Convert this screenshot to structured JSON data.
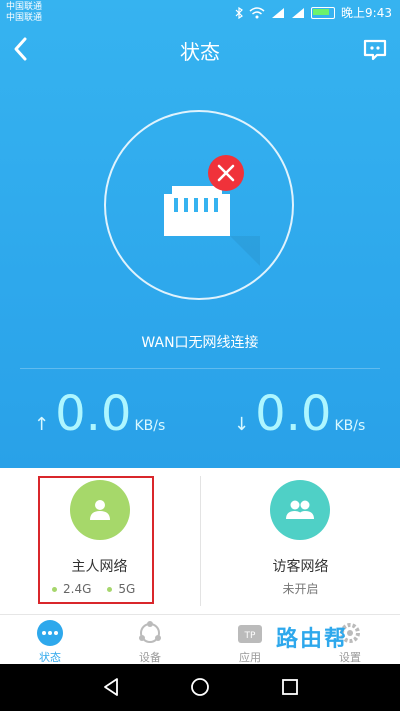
{
  "status_bar": {
    "carrier_1": "中国联通",
    "carrier_2": "中国联通",
    "time": "晚上9:43",
    "icons": [
      "bluetooth-icon",
      "wifi-icon",
      "signal-4g-icon",
      "signal-2g-icon",
      "battery-icon"
    ]
  },
  "header": {
    "title": "状态",
    "back_icon": "chevron-left-icon",
    "message_icon": "chat-bubble-icon"
  },
  "connection": {
    "status_text": "WAN口无网线连接",
    "error_icon": "close-icon",
    "router_icon": "router-port-icon"
  },
  "speed": {
    "upload_value": "0.0",
    "upload_unit": "KB/s",
    "download_value": "0.0",
    "download_unit": "KB/s"
  },
  "networks": {
    "host": {
      "label": "主人网络",
      "band_1": "2.4G",
      "band_2": "5G",
      "color": "#a6d86a"
    },
    "guest": {
      "label": "访客网络",
      "status": "未开启",
      "color": "#4fd0c6"
    }
  },
  "tabs": [
    {
      "label": "状态",
      "icon": "more-dots-icon",
      "active": true
    },
    {
      "label": "设备",
      "icon": "devices-icon",
      "active": false
    },
    {
      "label": "应用",
      "icon": "apps-tp-icon",
      "active": false
    },
    {
      "label": "设置",
      "icon": "gear-icon",
      "active": false
    }
  ],
  "watermark": "路由帮",
  "colors": {
    "accent": "#2ea8ec",
    "error": "#f0323a",
    "highlight_box": "#d9262b"
  }
}
